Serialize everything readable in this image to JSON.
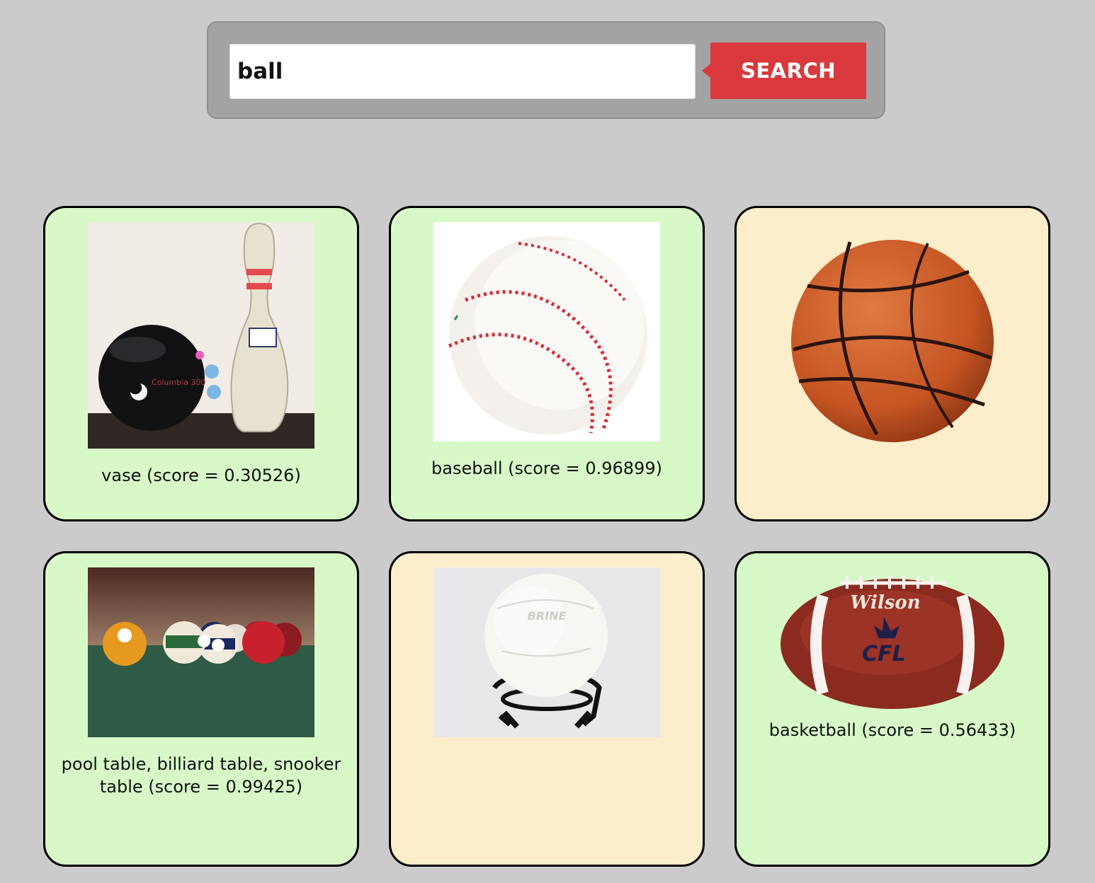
{
  "search": {
    "value": "ball",
    "button_label": "SEARCH"
  },
  "results": [
    {
      "caption": "vase (score = 0.30526)",
      "image": "bowling-ball-and-pin-photo",
      "highlight": "#d7f9c8"
    },
    {
      "caption": "baseball (score = 0.96899)",
      "image": "baseball-photo",
      "highlight": "#d7f9c8"
    },
    {
      "caption": "",
      "image": "basketball-photo",
      "highlight": "#fdeecb"
    },
    {
      "caption": "pool table, billiard table, snooker table (score = 0.99425)",
      "image": "billiard-balls-photo",
      "highlight": "#d7f9c8"
    },
    {
      "caption": "",
      "image": "white-ball-on-stand-photo",
      "highlight": "#fdeecb"
    },
    {
      "caption": "basketball (score = 0.56433)",
      "image": "american-football-photo",
      "highlight": "#d7f9c8"
    }
  ],
  "logo_text": {
    "football_brand": "Wilson",
    "football_league": "CFL",
    "white_ball_brand": "BRINE"
  },
  "colors": {
    "page_background": "#cbcbcb",
    "search_bar": "#a3a3a3",
    "search_button": "#d9393d",
    "card_match": "#d7f9c8",
    "card_nomatch": "#fdeecb"
  }
}
